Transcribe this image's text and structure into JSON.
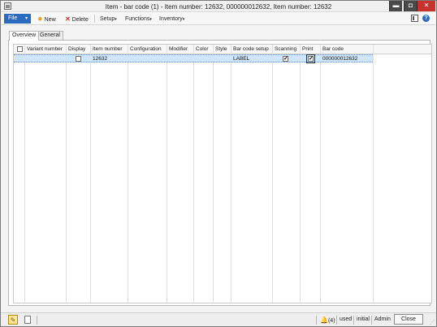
{
  "window": {
    "title": "Item - bar code (1) - Item number: 12632, 000000012632, Item number: 12632",
    "minimize_glyph": "▬",
    "maximize_glyph": "◘",
    "close_glyph": "✕"
  },
  "toolbar": {
    "file_label": "File",
    "file_caret": "▾",
    "new_label": "New",
    "delete_label": "Delete",
    "setup_label": "Setup",
    "functions_label": "Functions",
    "inventory_label": "Inventory",
    "dropdown_glyph": "▾",
    "help_glyph": "?"
  },
  "tabs": [
    {
      "label": "Overview",
      "active": true
    },
    {
      "label": "General",
      "active": false
    }
  ],
  "grid": {
    "columns": [
      "Variant number",
      "Display",
      "Item number",
      "Configuration",
      "Modifier",
      "Color",
      "Style",
      "Bar code setup",
      "Scanning",
      "Print",
      "Bar code"
    ],
    "rows": [
      {
        "variant_number": "",
        "display": false,
        "item_number": "12632",
        "configuration": "",
        "modifier": "",
        "color": "",
        "style": "",
        "bar_code_setup": "LABEL",
        "scanning": true,
        "print": true,
        "bar_code": "000000012632"
      }
    ]
  },
  "statusbar": {
    "notifications": "(4)",
    "bell_glyph": "🔔",
    "edit_glyph": "✎",
    "currency": "used",
    "company": "initial",
    "user": "Admin",
    "close_label": "Close",
    "grip_glyph": "⋰"
  },
  "colors": {
    "accent": "#2a6bbf",
    "selected_row": "#cfe6fa",
    "close_window": "#c7322c"
  }
}
